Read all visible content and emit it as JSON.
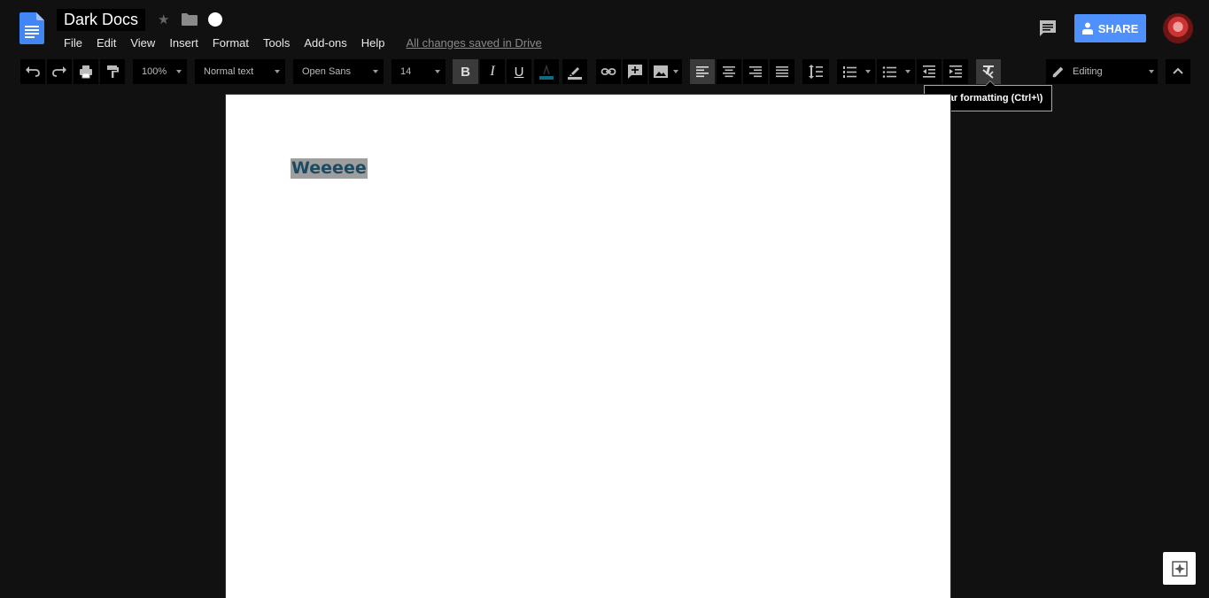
{
  "header": {
    "doc_title": "Dark Docs",
    "saved_status": "All changes saved in Drive",
    "share_label": "SHARE"
  },
  "menu": [
    "File",
    "Edit",
    "View",
    "Insert",
    "Format",
    "Tools",
    "Add-ons",
    "Help"
  ],
  "toolbar": {
    "zoom": "100%",
    "style": "Normal text",
    "font": "Open Sans",
    "font_size": "14",
    "bold_label": "B",
    "italic_label": "I",
    "underline_label": "U",
    "text_color": "#0f6a84",
    "mode": "Editing"
  },
  "tooltip": {
    "text": "Clear formatting (Ctrl+\\)"
  },
  "document": {
    "text": "Weeeee"
  },
  "colors": {
    "background": "#111111",
    "accent": "#4d90fe",
    "docs_blue": "#4285f4"
  }
}
